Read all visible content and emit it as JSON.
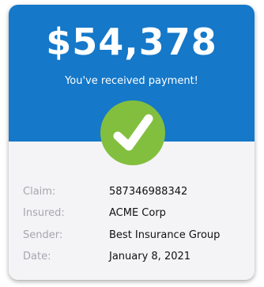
{
  "payment": {
    "amount": "$54,378",
    "message": "You've received payment!"
  },
  "status_icon": "checkmark-icon",
  "details": [
    {
      "label": "Claim:",
      "value": "587346988342"
    },
    {
      "label": "Insured:",
      "value": "ACME Corp"
    },
    {
      "label": "Sender:",
      "value": "Best Insurance Group"
    },
    {
      "label": "Date:",
      "value": "January 8, 2021"
    }
  ],
  "colors": {
    "header": "#1578c9",
    "badge": "#83bf3f",
    "details_bg": "#f4f4f6",
    "label": "#a6a6ae",
    "value": "#111111"
  }
}
